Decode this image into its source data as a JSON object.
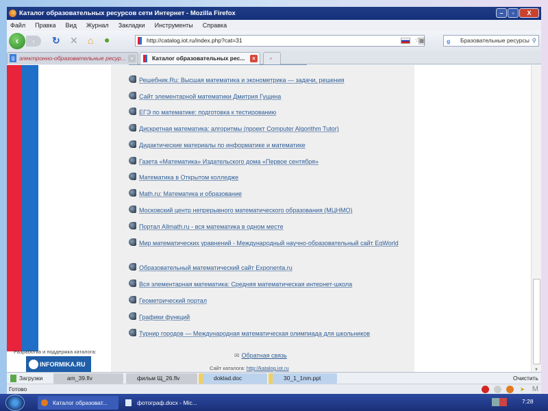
{
  "window": {
    "title": "Каталог образовательных ресурсов сети Интернет - Mozilla Firefox"
  },
  "menu": [
    "Файл",
    "Правка",
    "Вид",
    "Журнал",
    "Закладки",
    "Инструменты",
    "Справка"
  ],
  "nav": {
    "url": "http://catalog.iot.ru/index.php?cat=31",
    "search": "Бразовательные ресурсы"
  },
  "tabs": [
    {
      "label": "электронно-образовательные ресур..."
    },
    {
      "label": "Каталог образовательных рес..."
    }
  ],
  "links": [
    "Решебник.Ru: Высшая математика и эконометрика — задачи, решения",
    "Сайт элементарной математики Дмитрия Гущина",
    "ЕГЭ по математике: подготовка к тестированию",
    "Дискретная математика: алгоритмы (проект Computer Algorithm Tutor)",
    "Дидактические материалы по информатике и математике",
    "Газета «Математика» Издательского дома «Первое сентября»",
    "Математика в Открытом колледже",
    "Math.ru: Математика и образование",
    "Московский центр непрерывного математического образования (МЦНМО)",
    "Портал Allmath.ru - вся математика в одном месте",
    "Мир математических уравнений - Международный научно-образовательный сайт EqWorld",
    "Образовательный математический сайт Exponenta.ru",
    "Вся элементарная математика: Средняя математическая интернет-школа",
    "Геометрический портал",
    "Графики функций",
    "Турнир городов — Международная математическая олимпиада для школьников"
  ],
  "footer": {
    "dev_label": "Разработка и поддержка каталога:",
    "logo": "INFORMIKA.RU",
    "feedback": "Обратная связь",
    "site_label": "Сайт каталога:",
    "site_url": "http://katalog.iot.ru"
  },
  "downloads": {
    "label": "Загрузки",
    "items": [
      "am_39.flv",
      "фильм Щ_26.flv",
      "doklad.doc",
      "30_1_1nm.ppt"
    ],
    "clear": "Очистить"
  },
  "status": "Готово",
  "taskbar": {
    "items": [
      "Каталог образоват...",
      "фотограф.docx - Mic..."
    ],
    "clock": "7:28"
  }
}
